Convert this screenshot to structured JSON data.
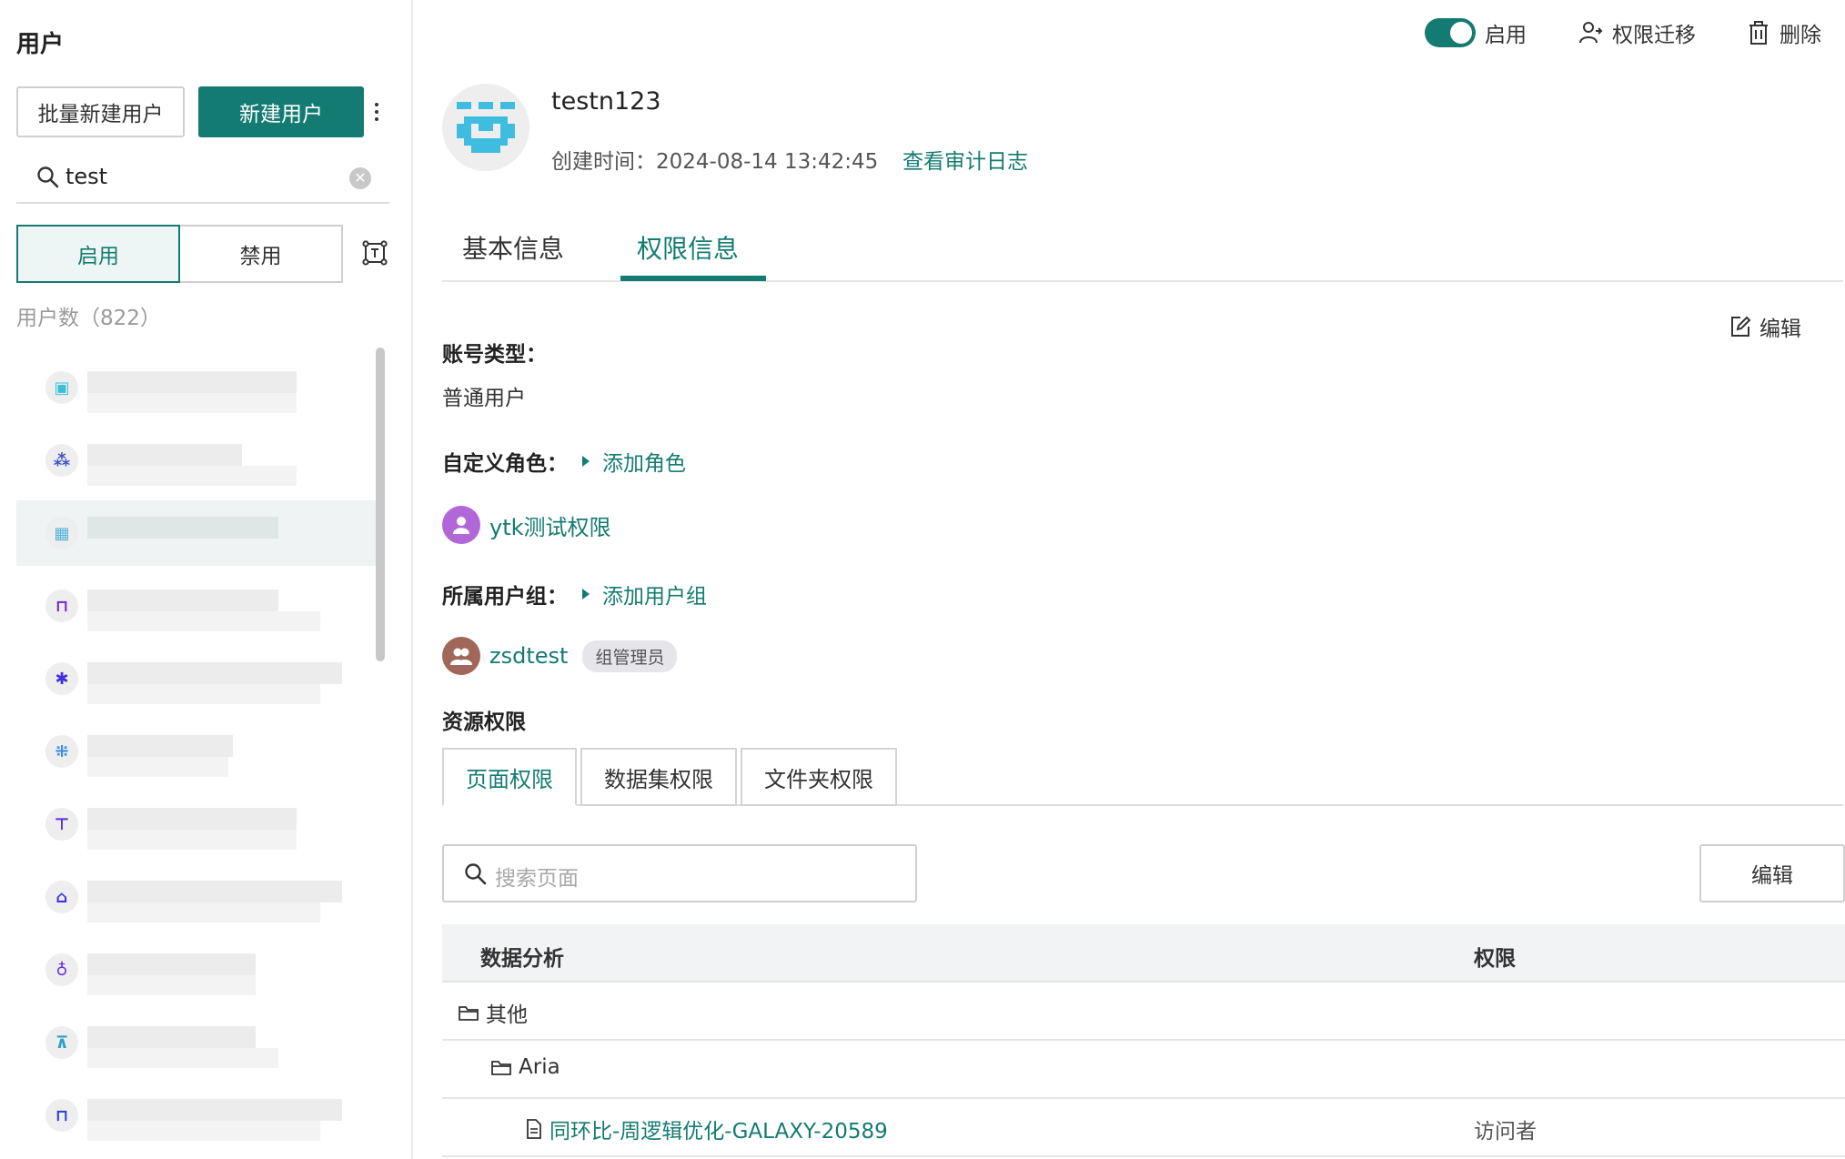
{
  "sidebar": {
    "title": "用户",
    "batch_create_label": "批量新建用户",
    "create_label": "新建用户",
    "search_value": "test",
    "filter_enabled_label": "启用",
    "filter_disabled_label": "禁用",
    "user_count_label": "用户数（822）",
    "users": [
      {
        "icon_color": "#37c0d8"
      },
      {
        "icon_color": "#3e50c9"
      },
      {
        "icon_color": "#52b3d9"
      },
      {
        "icon_color": "#7a27d6"
      },
      {
        "icon_color": "#3e2fe0"
      },
      {
        "icon_color": "#3b8fe0"
      },
      {
        "icon_color": "#5a2fd8"
      },
      {
        "icon_color": "#3e36d8"
      },
      {
        "icon_color": "#6234d8"
      },
      {
        "icon_color": "#2f9ec8"
      },
      {
        "icon_color": "#2e3fd6"
      }
    ]
  },
  "header_actions": {
    "enable_label": "启用",
    "migrate_label": "权限迁移",
    "delete_label": "删除"
  },
  "profile": {
    "name": "testn123",
    "created_label": "创建时间：2024-08-14 13:42:45",
    "audit_link": "查看审计日志"
  },
  "tabs": {
    "basic": "基本信息",
    "permission": "权限信息"
  },
  "permission_info": {
    "edit_label": "编辑",
    "account_type_label": "账号类型：",
    "account_type_value": "普通用户",
    "custom_role_label": "自定义角色：",
    "add_role_label": "添加角色",
    "role_name": "ytk测试权限",
    "user_group_label": "所属用户组：",
    "add_group_label": "添加用户组",
    "group_name": "zsdtest",
    "group_badge": "组管理员",
    "resource_label": "资源权限"
  },
  "resource_tabs": {
    "page": "页面权限",
    "dataset": "数据集权限",
    "folder": "文件夹权限"
  },
  "page_table": {
    "search_placeholder": "搜索页面",
    "edit_label": "编辑",
    "col_name": "数据分析",
    "col_permission": "权限",
    "rows": [
      {
        "name": "其他",
        "permission": ""
      },
      {
        "name": "Aria",
        "permission": ""
      },
      {
        "name": "同环比-周逻辑优化-GALAXY-20589",
        "permission": "访问者"
      }
    ]
  },
  "colors": {
    "accent": "#147b72",
    "role_avatar": "#b267d9",
    "group_avatar": "#a0675a"
  }
}
